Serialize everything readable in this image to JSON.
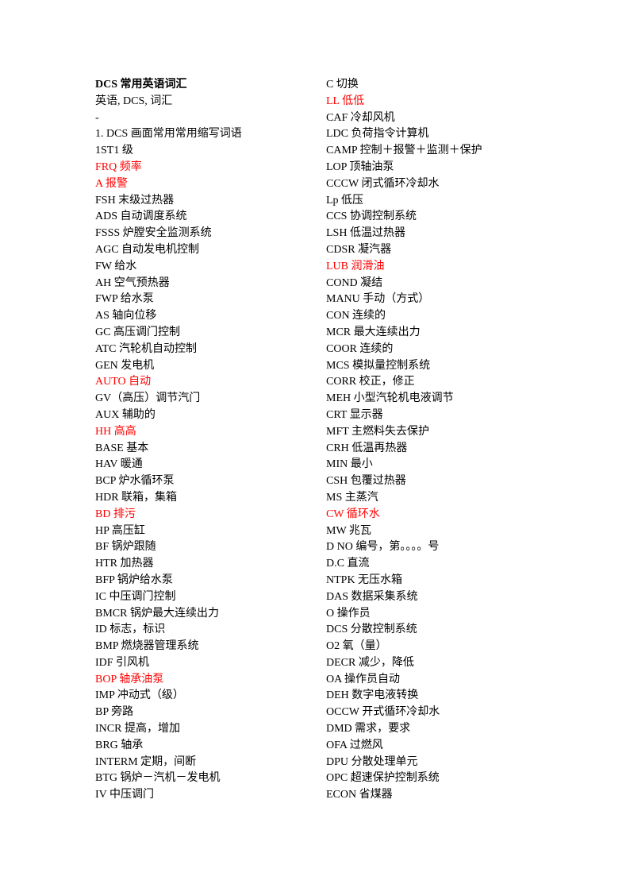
{
  "document": {
    "colors": {
      "highlight": "#ff0000",
      "text": "#000000"
    },
    "left_column": [
      {
        "text": "DCS  常用英语词汇",
        "style": "bold"
      },
      {
        "text": "英语, DCS,  词汇",
        "style": "normal"
      },
      {
        "text": "-",
        "style": "normal"
      },
      {
        "text": "1. DCS 画面常用常用缩写词语",
        "style": "normal"
      },
      {
        "text": "1ST1 级",
        "style": "normal"
      },
      {
        "text": "FRQ 频率",
        "style": "red"
      },
      {
        "text": "A 报警",
        "style": "red"
      },
      {
        "text": "FSH 末级过热器",
        "style": "normal"
      },
      {
        "text": "ADS 自动调度系统",
        "style": "normal"
      },
      {
        "text": "FSSS 炉膛安全监测系统",
        "style": "normal"
      },
      {
        "text": "AGC 自动发电机控制",
        "style": "normal"
      },
      {
        "text": "FW 给水",
        "style": "normal"
      },
      {
        "text": "AH 空气预热器",
        "style": "normal"
      },
      {
        "text": "FWP 给水泵",
        "style": "normal"
      },
      {
        "text": "AS 轴向位移",
        "style": "normal"
      },
      {
        "text": "GC 高压调门控制",
        "style": "normal"
      },
      {
        "text": "ATC 汽轮机自动控制",
        "style": "normal"
      },
      {
        "text": "GEN 发电机",
        "style": "normal"
      },
      {
        "text": "AUTO 自动",
        "style": "red"
      },
      {
        "text": "GV（高压）调节汽门",
        "style": "normal"
      },
      {
        "text": "AUX 辅助的",
        "style": "normal"
      },
      {
        "text": "HH 高高",
        "style": "red"
      },
      {
        "text": "BASE 基本",
        "style": "normal"
      },
      {
        "text": "HAV 暖通",
        "style": "normal"
      },
      {
        "text": "BCP 炉水循环泵",
        "style": "normal"
      },
      {
        "text": "HDR 联箱，集箱",
        "style": "normal"
      },
      {
        "text": "BD 排污",
        "style": "red"
      },
      {
        "text": "HP 高压缸",
        "style": "normal"
      },
      {
        "text": "BF 锅炉跟随",
        "style": "normal"
      },
      {
        "text": "HTR 加热器",
        "style": "normal"
      },
      {
        "text": "BFP 锅炉给水泵",
        "style": "normal"
      },
      {
        "text": "IC 中压调门控制",
        "style": "normal"
      },
      {
        "text": "BMCR 锅炉最大连续出力",
        "style": "normal"
      },
      {
        "text": "ID 标志，标识",
        "style": "normal"
      },
      {
        "text": "BMP 燃烧器管理系统",
        "style": "normal"
      },
      {
        "text": "IDF 引风机",
        "style": "normal"
      },
      {
        "text": "BOP 轴承油泵",
        "style": "red"
      },
      {
        "text": "IMP 冲动式（级）",
        "style": "normal"
      },
      {
        "text": "BP 旁路",
        "style": "normal"
      },
      {
        "text": "INCR 提高，增加",
        "style": "normal"
      },
      {
        "text": "BRG 轴承",
        "style": "normal"
      },
      {
        "text": "INTERM 定期，间断",
        "style": "normal"
      },
      {
        "text": "BTG 锅炉－汽机－发电机",
        "style": "normal"
      },
      {
        "text": "IV 中压调门",
        "style": "normal"
      }
    ],
    "right_column": [
      {
        "text": "C 切换",
        "style": "normal"
      },
      {
        "text": "LL 低低",
        "style": "red"
      },
      {
        "text": "CAF 冷却风机",
        "style": "normal"
      },
      {
        "text": "LDC 负荷指令计算机",
        "style": "normal"
      },
      {
        "text": "CAMP 控制＋报警＋监测＋保护",
        "style": "normal"
      },
      {
        "text": "LOP 顶轴油泵",
        "style": "normal"
      },
      {
        "text": "CCCW 闭式循环冷却水",
        "style": "normal"
      },
      {
        "text": "Lp 低压",
        "style": "normal"
      },
      {
        "text": "CCS 协调控制系统",
        "style": "normal"
      },
      {
        "text": "LSH 低温过热器",
        "style": "normal"
      },
      {
        "text": "CDSR 凝汽器",
        "style": "normal"
      },
      {
        "text": "LUB 润滑油",
        "style": "red"
      },
      {
        "text": "COND 凝结",
        "style": "normal"
      },
      {
        "text": "MANU 手动（方式）",
        "style": "normal"
      },
      {
        "text": "CON 连续的",
        "style": "normal"
      },
      {
        "text": "MCR 最大连续出力",
        "style": "normal"
      },
      {
        "text": "COOR 连续的",
        "style": "normal"
      },
      {
        "text": "MCS 模拟量控制系统",
        "style": "normal"
      },
      {
        "text": "CORR 校正，修正",
        "style": "normal"
      },
      {
        "text": "MEH 小型汽轮机电液调节",
        "style": "normal"
      },
      {
        "text": "CRT 显示器",
        "style": "normal"
      },
      {
        "text": "MFT 主燃料失去保护",
        "style": "normal"
      },
      {
        "text": "CRH 低温再热器",
        "style": "normal"
      },
      {
        "text": "MIN 最小",
        "style": "normal"
      },
      {
        "text": "CSH 包覆过热器",
        "style": "normal"
      },
      {
        "text": "MS 主蒸汽",
        "style": "normal"
      },
      {
        "text": "CW 循环水",
        "style": "red"
      },
      {
        "text": "MW 兆瓦",
        "style": "normal"
      },
      {
        "text": "D NO 编号，第。。。。号",
        "style": "normal"
      },
      {
        "text": "D.C 直流",
        "style": "normal"
      },
      {
        "text": "NTPK 无压水箱",
        "style": "normal"
      },
      {
        "text": "DAS 数据采集系统",
        "style": "normal"
      },
      {
        "text": "O 操作员",
        "style": "normal"
      },
      {
        "text": "DCS 分散控制系统",
        "style": "normal"
      },
      {
        "text": "O2 氧（量）",
        "style": "normal"
      },
      {
        "text": "DECR 减少，降低",
        "style": "normal"
      },
      {
        "text": "OA 操作员自动",
        "style": "normal"
      },
      {
        "text": "DEH 数字电液转换",
        "style": "normal"
      },
      {
        "text": "OCCW 开式循环冷却水",
        "style": "normal"
      },
      {
        "text": "DMD 需求，要求",
        "style": "normal"
      },
      {
        "text": "OFA 过燃风",
        "style": "normal"
      },
      {
        "text": "DPU 分散处理单元",
        "style": "normal"
      },
      {
        "text": "OPC 超速保护控制系统",
        "style": "normal"
      },
      {
        "text": "ECON 省煤器",
        "style": "normal"
      }
    ]
  }
}
